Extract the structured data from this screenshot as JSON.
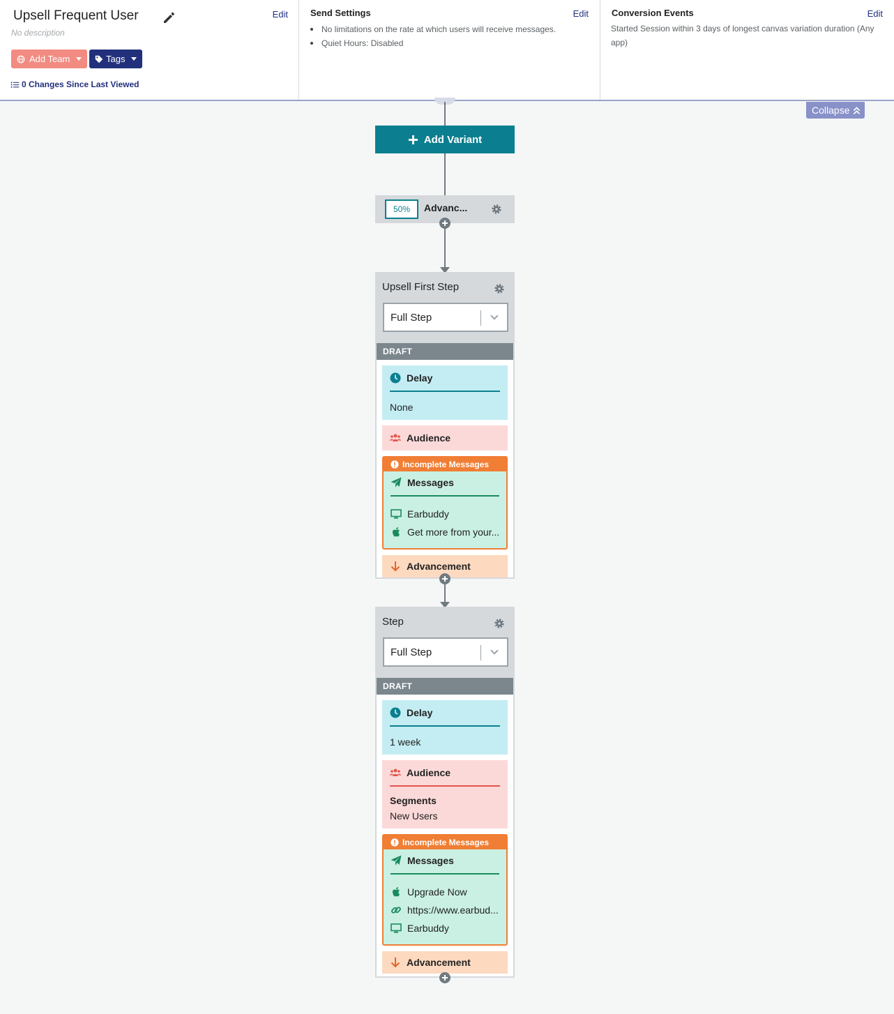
{
  "header": {
    "canvas": {
      "title": "Upsell Frequent User",
      "description": "No description",
      "edit_label": "Edit",
      "add_team_label": "Add Team",
      "tags_label": "Tags",
      "changes_label": "0 Changes Since Last Viewed"
    },
    "send_settings": {
      "title": "Send Settings",
      "edit_label": "Edit",
      "items": [
        "No limitations on the rate at which users will receive messages.",
        "Quiet Hours: Disabled"
      ]
    },
    "conversion": {
      "title": "Conversion Events",
      "edit_label": "Edit",
      "text": "Started Session within 3 days of longest canvas variation duration (Any app)"
    }
  },
  "canvas": {
    "collapse_label": "Collapse",
    "add_variant_label": "Add Variant",
    "variant": {
      "percent": "50%",
      "name": "Advanc..."
    },
    "steps": [
      {
        "name": "Upsell First Step",
        "type": "Full Step",
        "status": "DRAFT",
        "delay_title": "Delay",
        "delay_value": "None",
        "audience_title": "Audience",
        "warning": "Incomplete Messages",
        "messages_title": "Messages",
        "messages": [
          "Earbuddy",
          "Get more from your..."
        ],
        "advancement_title": "Advancement"
      },
      {
        "name": "Step",
        "type": "Full Step",
        "status": "DRAFT",
        "delay_title": "Delay",
        "delay_value": "1 week",
        "audience_title": "Audience",
        "segments_label": "Segments",
        "segments_value": "New Users",
        "warning": "Incomplete Messages",
        "messages_title": "Messages",
        "messages": [
          "Upgrade Now",
          "https://www.earbud...",
          "Earbuddy"
        ],
        "advancement_title": "Advancement"
      }
    ]
  },
  "colors": {
    "brand_navy": "#22307c",
    "teal": "#0b7f8f",
    "team_pink": "#f28b82",
    "warning_orange": "#f07e34",
    "delay_bg": "#c3edf3",
    "audience_bg": "#fcd9d9",
    "messages_bg": "#c9f0e3",
    "advancement_bg": "#fdd9bf"
  }
}
